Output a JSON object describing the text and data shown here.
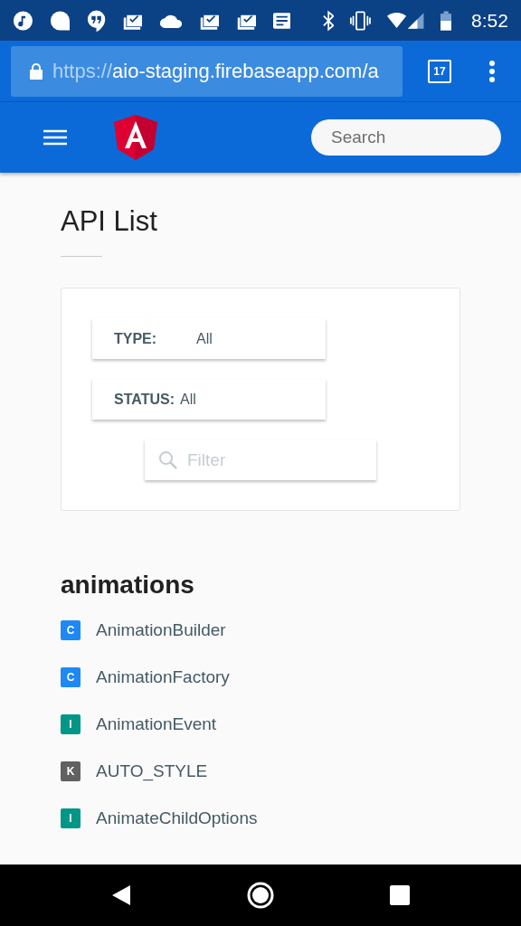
{
  "status_bar": {
    "time": "8:52"
  },
  "browser": {
    "url_scheme": "https://",
    "url_rest": "aio-staging.firebaseapp.com/a",
    "tab_count": "17"
  },
  "toolbar": {
    "search_placeholder": "Search"
  },
  "page": {
    "title": "API List"
  },
  "filters": {
    "selects": [
      {
        "label": "TYPE:",
        "value": "All",
        "wide": true
      },
      {
        "label": "STATUS:",
        "value": "All",
        "wide": false
      }
    ],
    "filter_placeholder": "Filter"
  },
  "section": {
    "title": "animations",
    "items": [
      {
        "badge": "C",
        "kind": "class",
        "name": "AnimationBuilder"
      },
      {
        "badge": "C",
        "kind": "class",
        "name": "AnimationFactory"
      },
      {
        "badge": "I",
        "kind": "interface",
        "name": "AnimationEvent"
      },
      {
        "badge": "K",
        "kind": "const",
        "name": "AUTO_STYLE"
      },
      {
        "badge": "I",
        "kind": "interface",
        "name": "AnimateChildOptions"
      }
    ]
  }
}
